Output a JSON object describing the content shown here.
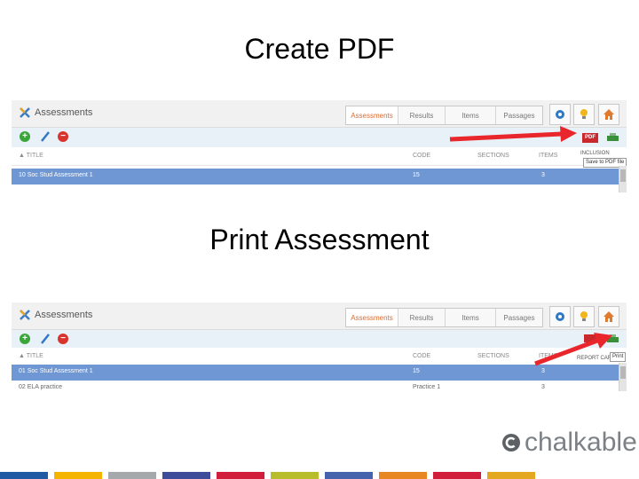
{
  "titles": {
    "create_pdf": "Create PDF",
    "print_assessment": "Print Assessment"
  },
  "app": {
    "name": "Assessments",
    "tabs": [
      "Assessments",
      "Results",
      "Items",
      "Passages"
    ],
    "active_tab": "Assessments"
  },
  "grid": {
    "columns": [
      "▲ TITLE",
      "CODE",
      "SECTIONS",
      "ITEMS"
    ]
  },
  "screenshot1": {
    "rows": [
      {
        "title": "10 Soc Stud Assessment 1",
        "code": "15",
        "sections": "",
        "items": "3",
        "selected": true
      }
    ],
    "pdf_label": "PDF",
    "inclusion_label": "INCLUSION",
    "tooltip": "Save to PDF file"
  },
  "screenshot2": {
    "rows": [
      {
        "title": "01 Soc Stud Assessment 1",
        "code": "15",
        "sections": "",
        "items": "3",
        "selected": true
      },
      {
        "title": "02 ELA practice",
        "code": "Practice 1",
        "sections": "",
        "items": "3",
        "selected": false
      }
    ],
    "report_label": "REPORT CARD",
    "tooltip": "Print"
  },
  "brand": {
    "name": "chalkable"
  },
  "colors": {
    "arrow": "#e8262b",
    "selected_row": "#6f97d3",
    "toolbar_bg": "#e9f1f8",
    "active_tab": "#e06a2c",
    "footer": [
      "#1f5aa3",
      "#f5b400",
      "#a6a9ab",
      "#3d4d9a",
      "#d11e3a",
      "#b7bd2b",
      "#4563ad",
      "#e88721",
      "#d11e3a",
      "#e4a820"
    ]
  }
}
